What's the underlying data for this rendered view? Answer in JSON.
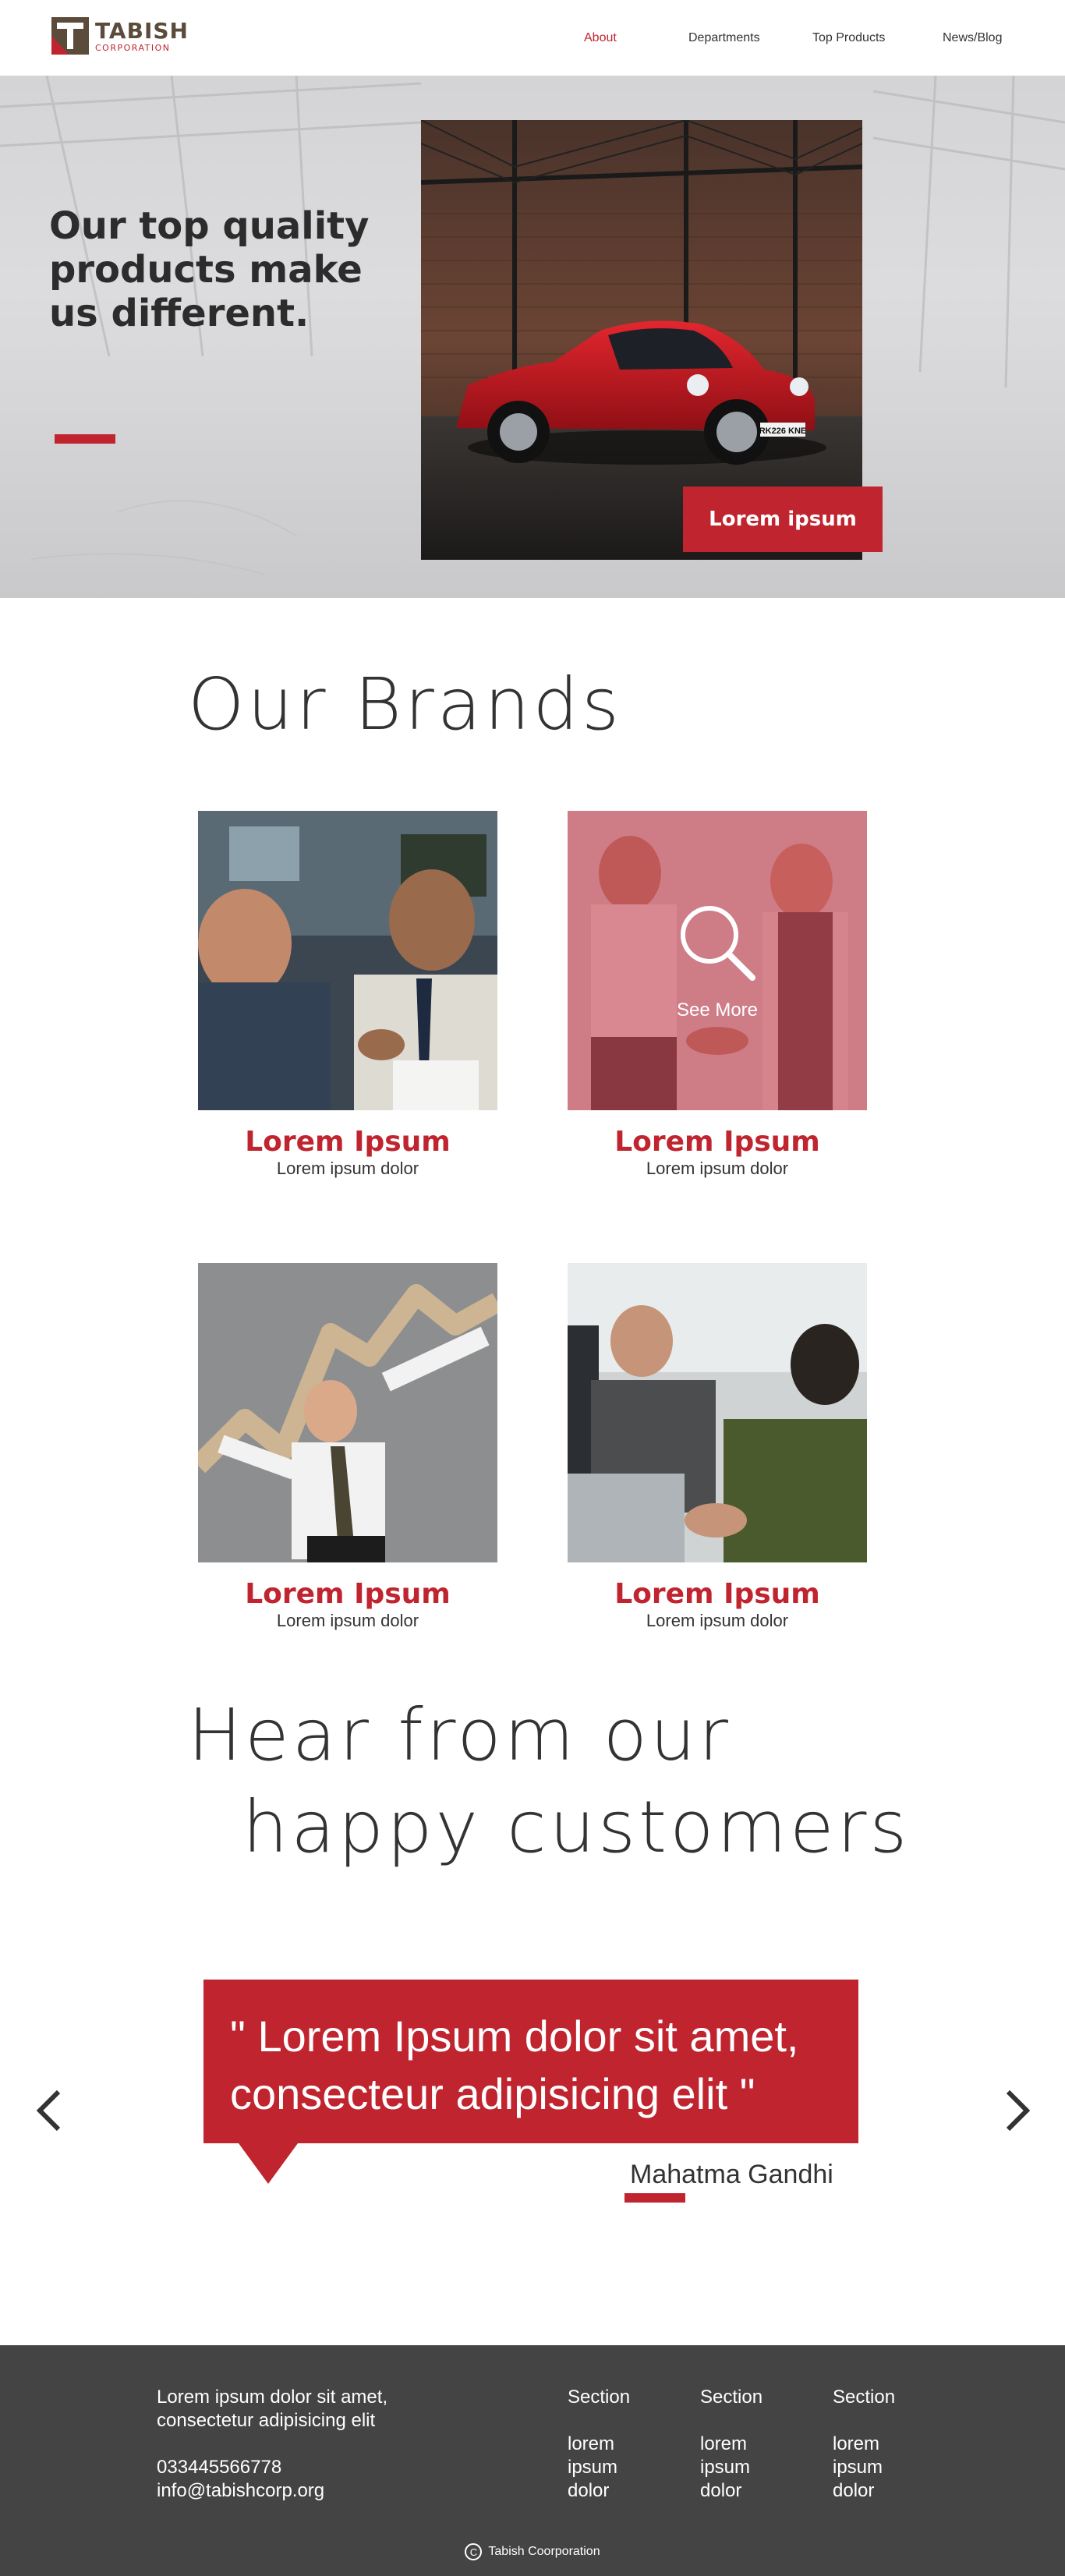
{
  "header": {
    "logo": {
      "name": "TABISH",
      "sub": "CORPORATION"
    },
    "nav": [
      {
        "label": "About",
        "active": true
      },
      {
        "label": "Departments",
        "active": false
      },
      {
        "label": "Top Products",
        "active": false
      },
      {
        "label": "News/Blog",
        "active": false
      }
    ]
  },
  "hero": {
    "headline": "Our top quality products make us different.",
    "cta_label": "Lorem ipsum",
    "plate_text": "RK226 KNE"
  },
  "brands": {
    "heading": "Our Brands",
    "items": [
      {
        "title": "Lorem Ipsum",
        "subtitle": "Lorem ipsum dolor"
      },
      {
        "title": "Lorem Ipsum",
        "subtitle": "Lorem ipsum dolor",
        "overlay_label": "See More"
      },
      {
        "title": "Lorem Ipsum",
        "subtitle": "Lorem ipsum dolor"
      },
      {
        "title": "Lorem Ipsum",
        "subtitle": "Lorem ipsum dolor"
      }
    ]
  },
  "testimonials": {
    "heading_line1": "Hear from our",
    "heading_line2": "happy customers",
    "quote": "\" Lorem Ipsum dolor sit amet, consecteur adipisicing elit \"",
    "author": "Mahatma Gandhi"
  },
  "footer": {
    "about_line1": "Lorem ipsum dolor sit amet,",
    "about_line2": "consectetur adipisicing elit",
    "phone": "033445566778",
    "email": "info@tabishcorp.org",
    "sections": [
      {
        "head": "Section",
        "items": [
          "lorem",
          "ipsum",
          "dolor"
        ]
      },
      {
        "head": "Section",
        "items": [
          "lorem",
          "ipsum",
          "dolor"
        ]
      },
      {
        "head": "Section",
        "items": [
          "lorem",
          "ipsum",
          "dolor"
        ]
      }
    ],
    "copyright": "Tabish Coorporation"
  },
  "colors": {
    "accent": "#c0242f",
    "footer_bg": "#444444",
    "text": "#333333"
  },
  "icons": [
    "search-icon",
    "chevron-left-icon",
    "chevron-right-icon",
    "copyright-icon"
  ]
}
